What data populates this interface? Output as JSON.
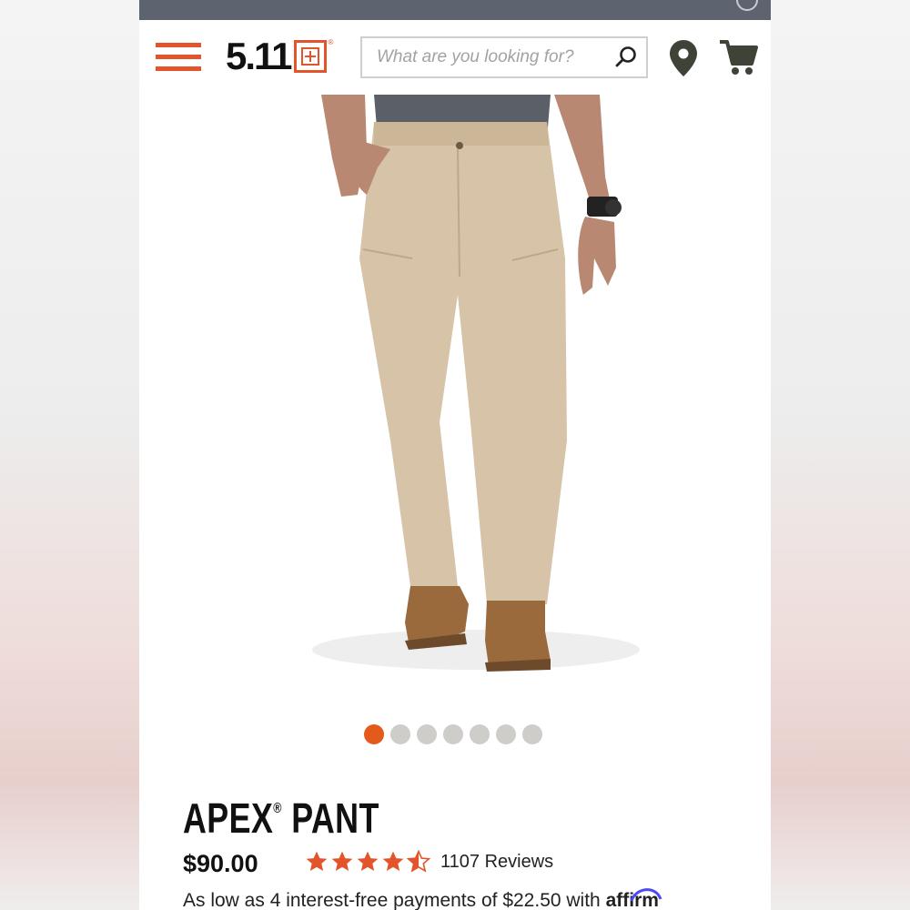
{
  "header": {
    "logo_text": "5.11",
    "search": {
      "placeholder": "What are you looking for?"
    },
    "icons": [
      "menu-icon",
      "search-icon",
      "location-pin-icon",
      "cart-icon"
    ]
  },
  "product": {
    "gallery": {
      "image_count": 7,
      "active_index": 0
    },
    "name_main": "APEX",
    "name_reg": "®",
    "name_rest": " PANT",
    "price": "$90.00",
    "rating": 4.5,
    "reviews_text": "1107 Reviews",
    "financing_text": "As low as 4 interest-free payments of $22.50 with ",
    "affirm_text": "affirm"
  },
  "colors": {
    "accent": "#e4542b",
    "status_bar": "#5d6470",
    "star": "#e4542b",
    "active_dot": "#e45a1a",
    "inactive_dot": "#cfcdc9"
  }
}
